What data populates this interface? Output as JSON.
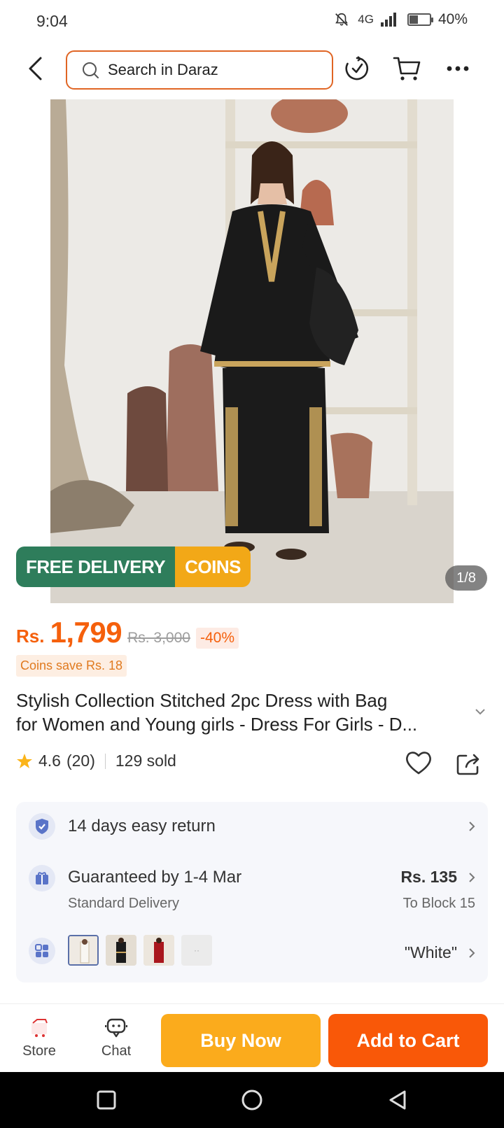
{
  "status_bar": {
    "time": "9:04",
    "network": "4G",
    "battery": "40%",
    "battery_level": 0.4
  },
  "header": {
    "search_placeholder": "Search in Daraz"
  },
  "gallery": {
    "counter": "1/8",
    "badge_free": "FREE DELIVERY",
    "badge_coins": "COINS"
  },
  "price": {
    "currency": "Rs.",
    "current": "1,799",
    "original": "Rs. 3,000",
    "discount": "-40%",
    "coins_save": "Coins save Rs. 18"
  },
  "product": {
    "title_line1": "Stylish Collection Stitched 2pc Dress with Bag",
    "title_line2": "for Women and Young girls - Dress For Girls - D...",
    "rating": "4.6",
    "reviews": "(20)",
    "sold": "129 sold"
  },
  "info": {
    "returns": "14 days easy return",
    "delivery_main": "Guaranteed by 1-4 Mar",
    "delivery_sub": "Standard Delivery",
    "delivery_price": "Rs. 135",
    "delivery_location": "To Block 15",
    "variant": "\"White\""
  },
  "bottom_bar": {
    "store": "Store",
    "chat": "Chat",
    "buy_now": "Buy Now",
    "add_to_cart": "Add to Cart"
  },
  "colors": {
    "brand_orange": "#f95808",
    "buy_yellow": "#fbab1c",
    "price_orange": "#f5600c",
    "delivery_green": "#2e7d5b"
  }
}
